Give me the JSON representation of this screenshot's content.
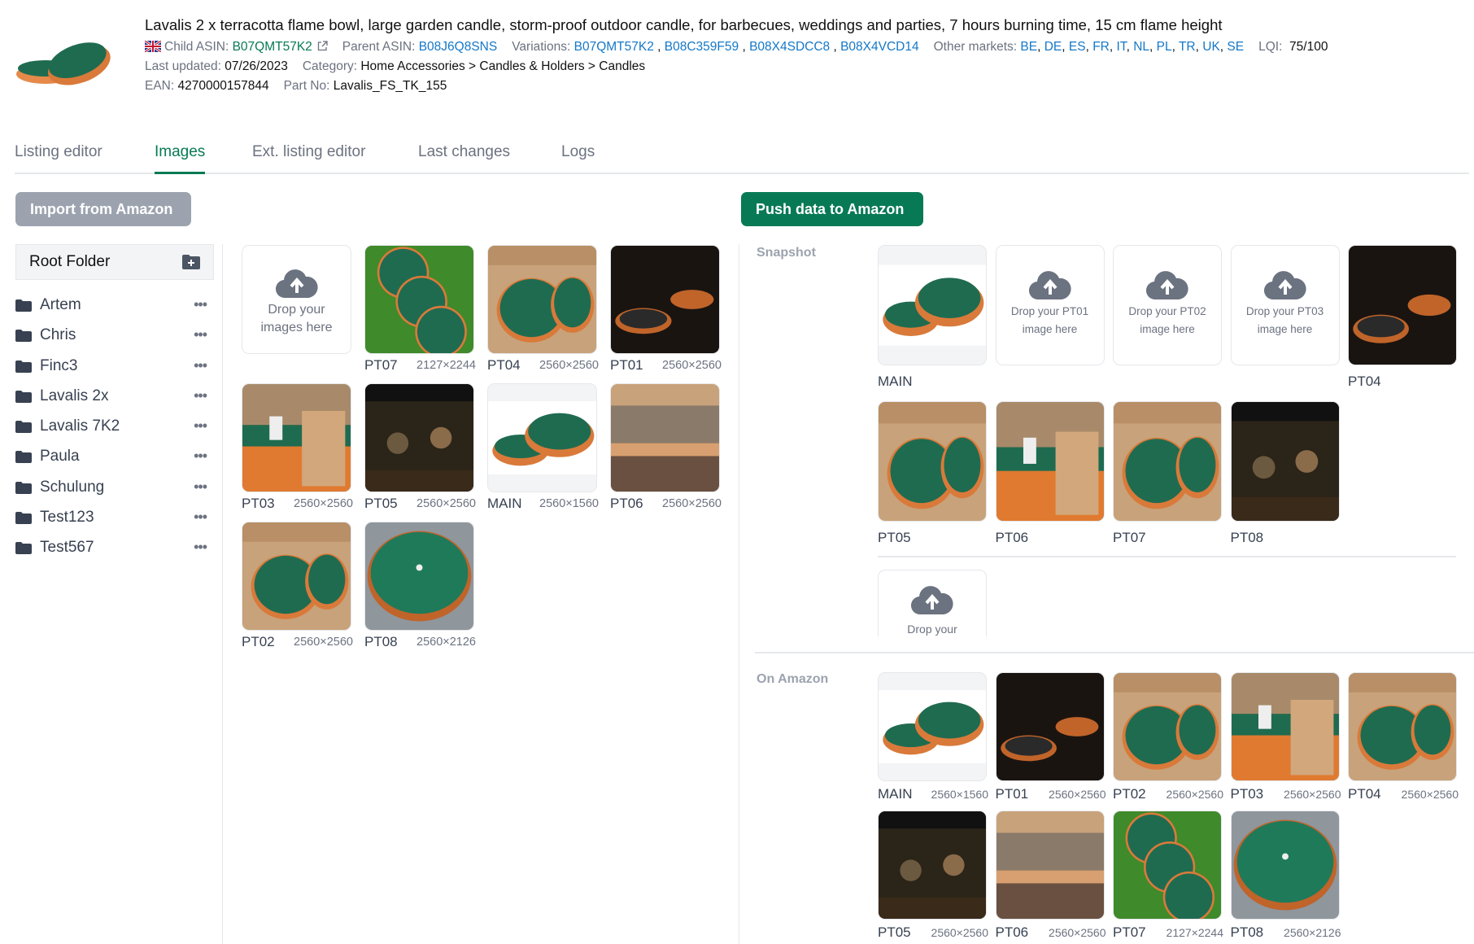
{
  "product": {
    "title": "Lavalis 2 x terracotta flame bowl, large garden candle, storm-proof outdoor candle, for barbecues, weddings and parties, 7 hours burning time, 15 cm flame height",
    "marketplace_flag": "uk-flag-icon",
    "child_asin_label": "Child ASIN:",
    "child_asin": "B07QMT57K2",
    "parent_asin_label": "Parent ASIN:",
    "parent_asin": "B08J6Q8SNS",
    "variations_label": "Variations:",
    "variations": [
      "B07QMT57K2",
      "B08C359F59",
      "B08X4SDCC8",
      "B08X4VCD14"
    ],
    "other_markets_label": "Other markets:",
    "other_markets": [
      "BE",
      "DE",
      "ES",
      "FR",
      "IT",
      "NL",
      "PL",
      "TR",
      "UK",
      "SE"
    ],
    "lqi_label": "LQI:",
    "lqi": "75/100",
    "last_updated_label": "Last updated:",
    "last_updated": "07/26/2023",
    "category_label": "Category:",
    "category": "Home Accessories > Candles & Holders > Candles",
    "ean_label": "EAN:",
    "ean": "4270000157844",
    "part_no_label": "Part No:",
    "part_no": "Lavalis_FS_TK_155"
  },
  "tabs": [
    {
      "label": "Listing editor"
    },
    {
      "label": "Images",
      "active": true
    },
    {
      "label": "Ext. listing editor"
    },
    {
      "label": "Last changes"
    },
    {
      "label": "Logs"
    }
  ],
  "buttons": {
    "import": "Import from Amazon",
    "push": "Push data to Amazon"
  },
  "folders": {
    "root": "Root Folder",
    "items": [
      "Artem",
      "Chris",
      "Finc3",
      "Lavalis 2x",
      "Lavalis 7K2",
      "Paula",
      "Schulung",
      "Test123",
      "Test567"
    ],
    "more": "•••"
  },
  "library": {
    "drop_text_1": "Drop your",
    "drop_text_2": "images here",
    "images": [
      {
        "slot": "PT07",
        "size": "2127×2244",
        "thumb": "grass"
      },
      {
        "slot": "PT04",
        "size": "2560×2560",
        "thumb": "beige"
      },
      {
        "slot": "PT01",
        "size": "2560×2560",
        "thumb": "dark"
      },
      {
        "slot": "PT03",
        "size": "2560×2560",
        "thumb": "beige-orange"
      },
      {
        "slot": "PT05",
        "size": "2560×2560",
        "thumb": "night"
      },
      {
        "slot": "MAIN",
        "size": "2560×1560",
        "thumb": "product"
      },
      {
        "slot": "PT06",
        "size": "2560×2560",
        "thumb": "sunset"
      },
      {
        "slot": "PT02",
        "size": "2560×2560",
        "thumb": "beige"
      },
      {
        "slot": "PT08",
        "size": "2560×2126",
        "thumb": "stone"
      }
    ]
  },
  "snapshot": {
    "title": "Snapshot",
    "slots": [
      {
        "slot": "MAIN",
        "thumb": "product"
      },
      {
        "slot": "PT01",
        "drop": "Drop your PT01",
        "drop2": "image here"
      },
      {
        "slot": "PT02",
        "drop": "Drop your PT02",
        "drop2": "image here"
      },
      {
        "slot": "PT03",
        "drop": "Drop your PT03",
        "drop2": "image here"
      },
      {
        "slot": "PT04",
        "thumb": "dark"
      },
      {
        "slot": "PT05",
        "thumb": "beige"
      },
      {
        "slot": "PT06",
        "thumb": "beige-orange"
      },
      {
        "slot": "PT07",
        "thumb": "beige"
      },
      {
        "slot": "PT08",
        "thumb": "night"
      }
    ],
    "extra_drop": "Drop your"
  },
  "on_amazon": {
    "title": "On Amazon",
    "images": [
      {
        "slot": "MAIN",
        "size": "2560×1560",
        "thumb": "product"
      },
      {
        "slot": "PT01",
        "size": "2560×2560",
        "thumb": "dark"
      },
      {
        "slot": "PT02",
        "size": "2560×2560",
        "thumb": "beige"
      },
      {
        "slot": "PT03",
        "size": "2560×2560",
        "thumb": "beige-orange"
      },
      {
        "slot": "PT04",
        "size": "2560×2560",
        "thumb": "beige"
      },
      {
        "slot": "PT05",
        "size": "2560×2560",
        "thumb": "night"
      },
      {
        "slot": "PT06",
        "size": "2560×2560",
        "thumb": "sunset"
      },
      {
        "slot": "PT07",
        "size": "2127×2244",
        "thumb": "grass"
      },
      {
        "slot": "PT08",
        "size": "2560×2126",
        "thumb": "stone"
      }
    ]
  },
  "colors": {
    "accent": "#077a55",
    "link": "#1478c8",
    "muted": "#6b7280",
    "disabled_button": "#9ca3af"
  }
}
